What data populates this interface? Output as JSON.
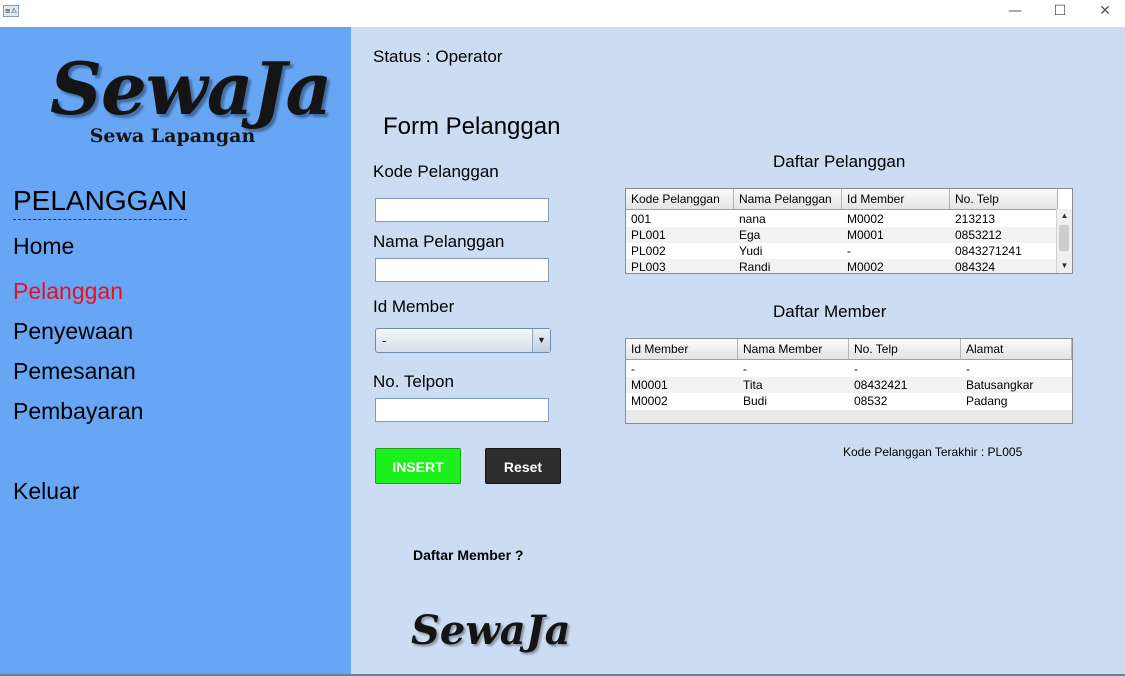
{
  "window": {
    "icon_text": "≡⚠",
    "minimize": "—",
    "maximize": "☐",
    "close": "✕"
  },
  "sidebar": {
    "logo_main": "SewaJa",
    "logo_sub": "Sewa Lapangan",
    "section_title": "PELANGGAN",
    "items": [
      {
        "label": "Home"
      },
      {
        "label": "Pelanggan"
      },
      {
        "label": "Penyewaan"
      },
      {
        "label": "Pemesanan"
      },
      {
        "label": "Pembayaran"
      },
      {
        "label": "Keluar"
      }
    ],
    "active_color": "#e8101e"
  },
  "main": {
    "status": "Status :  Operator",
    "form_title": "Form Pelanggan",
    "fields": {
      "kode_label": "Kode Pelanggan",
      "kode_value": "",
      "nama_label": "Nama Pelanggan",
      "nama_value": "",
      "member_label": "Id Member",
      "member_selected": "-",
      "telp_label": "No. Telpon",
      "telp_value": ""
    },
    "buttons": {
      "insert": "INSERT",
      "reset": "Reset"
    },
    "daftar_member_link": "Daftar Member ?",
    "bottom_logo": "SewaJa",
    "last_code": "Kode Pelanggan Terakhir : PL005"
  },
  "pelanggan_table": {
    "title": "Daftar Pelanggan",
    "headers": [
      "Kode Pelanggan",
      "Nama Pelanggan",
      "Id Member",
      "No. Telp"
    ],
    "rows": [
      [
        "001",
        "nana",
        "M0002",
        "213213"
      ],
      [
        "PL001",
        "Ega",
        "M0001",
        "0853212"
      ],
      [
        "PL002",
        "Yudi",
        "-",
        "0843271241"
      ],
      [
        "PL003",
        "Randi",
        "M0002",
        "084324"
      ]
    ]
  },
  "member_table": {
    "title": "Daftar Member",
    "headers": [
      "Id Member",
      "Nama Member",
      "No. Telp",
      "Alamat"
    ],
    "rows": [
      [
        "-",
        "-",
        "-",
        "-"
      ],
      [
        "M0001",
        "Tita",
        "08432421",
        "Batusangkar"
      ],
      [
        "M0002",
        "Budi",
        "08532",
        "Padang"
      ]
    ]
  }
}
